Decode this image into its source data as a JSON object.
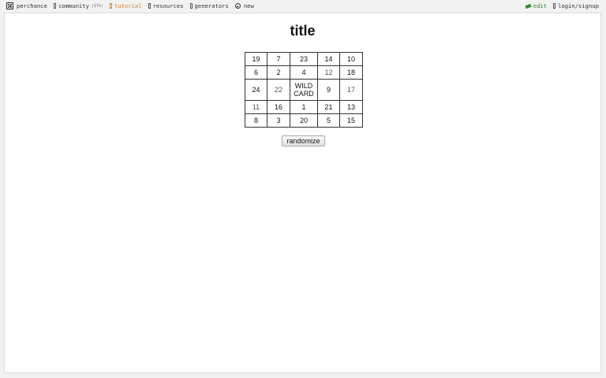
{
  "topbar": {
    "left": [
      {
        "label": "perchance",
        "icon": "die-icon"
      },
      {
        "label": "community",
        "count": "(17h)",
        "icon": "chat-icon"
      },
      {
        "label": "tutorial",
        "icon": "book-icon"
      },
      {
        "label": "resources",
        "icon": "link-icon"
      },
      {
        "label": "generators",
        "icon": "folder-icon"
      },
      {
        "label": "new",
        "icon": "plus-circle-icon"
      }
    ],
    "right": [
      {
        "label": "edit",
        "icon": "pencil-icon"
      },
      {
        "label": "login/signup",
        "icon": "user-icon"
      }
    ]
  },
  "page": {
    "title": "title",
    "button_label": "randomize"
  },
  "grid": [
    [
      "19",
      "7",
      "23",
      "14",
      "10"
    ],
    [
      "6",
      "2",
      "4",
      "12",
      "18"
    ],
    [
      "24",
      "22",
      "WILD CARD",
      "9",
      "17"
    ],
    [
      "11",
      "16",
      "1",
      "21",
      "13"
    ],
    [
      "8",
      "3",
      "20",
      "5",
      "15"
    ]
  ],
  "colors": {
    "accent_tutorial": "#d9822b",
    "accent_edit": "#2a8a2a"
  }
}
